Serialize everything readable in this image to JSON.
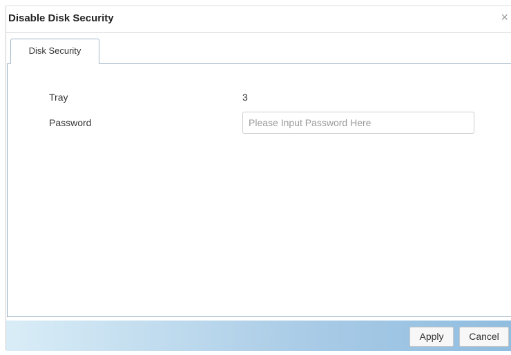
{
  "dialog": {
    "title": "Disable Disk Security",
    "close_glyph": "×",
    "close_icon": "close-icon"
  },
  "tabs": [
    {
      "label": "Disk Security",
      "active": true
    }
  ],
  "form": {
    "tray_label": "Tray",
    "tray_value": "3",
    "password_label": "Password",
    "password_value": "",
    "password_placeholder": "Please Input Password Here"
  },
  "footer": {
    "apply_label": "Apply",
    "cancel_label": "Cancel"
  },
  "colors": {
    "footer_gradient_start": "#d9edf7",
    "footer_gradient_end": "#90bde0",
    "tab_border": "#9fb5c8"
  }
}
